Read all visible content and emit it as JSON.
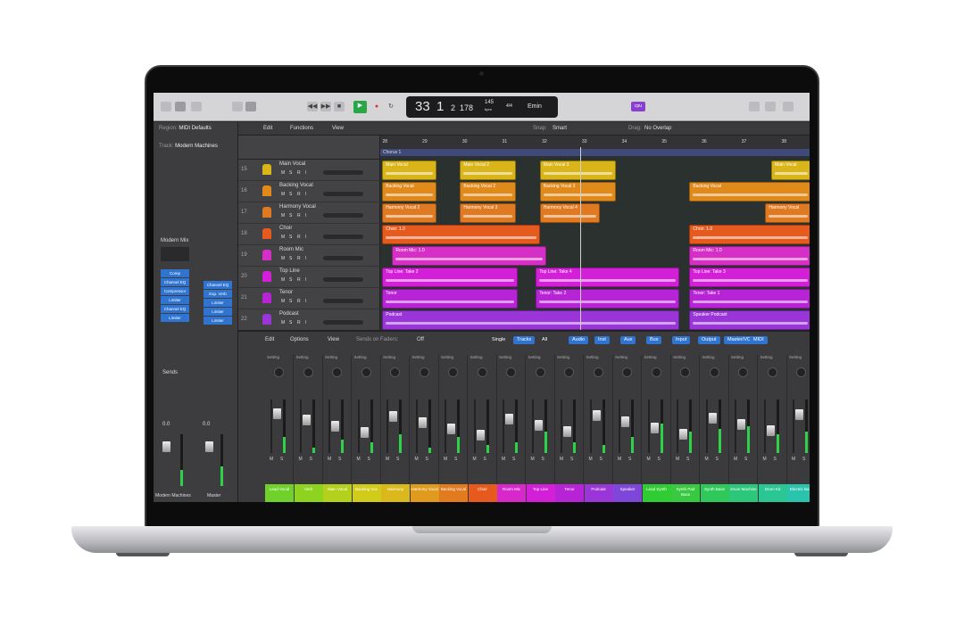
{
  "colors": {
    "accent": "#2f74d0",
    "play": "#27a745",
    "record": "#e0303a",
    "playhead": "#d0d0d0"
  },
  "control_bar": {
    "lcd": {
      "bar": "33",
      "beat": "1",
      "division": "2",
      "tick": "178",
      "tempo": "145",
      "tempo_label": "bpm",
      "signature": "4/4",
      "key": "Emin"
    },
    "badge": "cpu",
    "play_icon": "play-icon",
    "record_icon": "record-icon"
  },
  "arrange": {
    "menus": [
      "Edit",
      "Functions",
      "View"
    ],
    "snap_label": "Snap:",
    "snap_value": "Smart",
    "drag_label": "Drag:",
    "drag_value": "No Overlap",
    "ruler": [
      28,
      29,
      30,
      31,
      32,
      33,
      34,
      35,
      36,
      37,
      38
    ],
    "marker": "Chorus 1",
    "playhead_bar": 32.9,
    "tracks": [
      {
        "num": "15",
        "name": "Main Vocal",
        "color": "#d9b51a",
        "clips": [
          {
            "name": "Main Vocal",
            "start": 27.95,
            "end": 29.3
          },
          {
            "name": "Main Vocal 2",
            "start": 29.9,
            "end": 31.3
          },
          {
            "name": "Main Vocal 3",
            "start": 31.9,
            "end": 33.8
          },
          {
            "name": "Main Vocal",
            "start": 37.7,
            "end": 38.7
          }
        ]
      },
      {
        "num": "16",
        "name": "Backing Vocal",
        "color": "#e08a1c",
        "clips": [
          {
            "name": "Backing Vocal",
            "start": 27.95,
            "end": 29.3
          },
          {
            "name": "Backing Vocal 2",
            "start": 29.9,
            "end": 31.3
          },
          {
            "name": "Backing Vocal 3",
            "start": 31.9,
            "end": 33.8
          },
          {
            "name": "Backing Vocal",
            "start": 35.65,
            "end": 38.7
          }
        ]
      },
      {
        "num": "17",
        "name": "Harmony Vocal",
        "color": "#e07a22",
        "clips": [
          {
            "name": "Harmony Vocal 2",
            "start": 27.95,
            "end": 29.3
          },
          {
            "name": "Harmony Vocal 3",
            "start": 29.9,
            "end": 31.3
          },
          {
            "name": "Harmony Vocal 4",
            "start": 31.9,
            "end": 33.4
          },
          {
            "name": "Harmony Vocal",
            "start": 37.55,
            "end": 38.7
          }
        ]
      },
      {
        "num": "18",
        "name": "Choir",
        "color": "#e65a1e",
        "clips": [
          {
            "name": "Choir: 1.0",
            "start": 27.95,
            "end": 31.9
          },
          {
            "name": "Choir: 1.0",
            "start": 35.65,
            "end": 38.7
          }
        ]
      },
      {
        "num": "19",
        "name": "Room Mic",
        "color": "#d52fc6",
        "clips": [
          {
            "name": "Room Mic: 1.0",
            "start": 28.2,
            "end": 32.05
          },
          {
            "name": "Room Mic: 1.0",
            "start": 35.65,
            "end": 38.7
          }
        ]
      },
      {
        "num": "20",
        "name": "Top Line",
        "color": "#d41fd8",
        "clips": [
          {
            "name": "Top Line: Take 2",
            "start": 27.95,
            "end": 31.35
          },
          {
            "name": "Top Line: Take 4",
            "start": 31.8,
            "end": 35.4
          },
          {
            "name": "Top Line: Take 3",
            "start": 35.65,
            "end": 38.7
          }
        ]
      },
      {
        "num": "21",
        "name": "Tenor",
        "color": "#b624d6",
        "clips": [
          {
            "name": "Tenor",
            "start": 27.95,
            "end": 31.35
          },
          {
            "name": "Tenor: Take 2",
            "start": 31.8,
            "end": 35.4
          },
          {
            "name": "Tenor: Take 1",
            "start": 35.65,
            "end": 38.7
          }
        ]
      },
      {
        "num": "22",
        "name": "Podcast",
        "color": "#9a36d8",
        "clips": [
          {
            "name": "Podcast",
            "start": 27.95,
            "end": 35.4
          },
          {
            "name": "Speaker Podcast",
            "start": 35.65,
            "end": 38.7
          }
        ]
      }
    ],
    "track_buttons": [
      "M",
      "S",
      "R",
      "I"
    ]
  },
  "inspector": {
    "region_label": "Region:",
    "region_value": "MIDI Defaults",
    "track_label": "Track:",
    "track_value": "Modern Machines",
    "plugin_header": "Modern Mix",
    "plugins_left": [
      "Comp",
      "Channel EQ",
      "Compressor",
      "Limiter",
      "Channel EQ",
      "Limiter"
    ],
    "plugins_right": [
      "Channel EQ",
      "Exp. Verb",
      "Limiter",
      "Limiter",
      "Limiter"
    ],
    "sends": "Sends",
    "strip_left": "Modern Machines",
    "strip_right": "Master",
    "vol_left": "0.0",
    "vol_right": "0.0"
  },
  "mixer": {
    "menus": [
      "Edit",
      "Options",
      "View"
    ],
    "sends_label": "Sends on Faders:",
    "sends_value": "Off",
    "filters": [
      "Single",
      "Tracks",
      "All"
    ],
    "types": [
      "Audio",
      "Inst",
      "Aux",
      "Bus",
      "Input",
      "Output",
      "Master/VCA",
      "MIDI"
    ],
    "setting": "Setting",
    "channels": [
      {
        "name": "Lead Vocal",
        "color": "#6fd12a",
        "level": 0.3
      },
      {
        "name": "Verb",
        "color": "#8ed31f",
        "level": 0.1
      },
      {
        "name": "Main Vocal",
        "color": "#b3d11c",
        "level": 0.25
      },
      {
        "name": "Backing Vox",
        "color": "#d1cc1a",
        "level": 0.2
      },
      {
        "name": "Harmony",
        "color": "#dbb81b",
        "level": 0.35
      },
      {
        "name": "Harmony Vocal",
        "color": "#e09a1d",
        "level": 0.1
      },
      {
        "name": "Backing Vocal",
        "color": "#e27b1e",
        "level": 0.3
      },
      {
        "name": "Choir",
        "color": "#e65a1e",
        "level": 0.15
      },
      {
        "name": "Room Mic",
        "color": "#d728c9",
        "level": 0.2
      },
      {
        "name": "Top Line",
        "color": "#d41fd8",
        "level": 0.4
      },
      {
        "name": "Tenor",
        "color": "#b624d6",
        "level": 0.2
      },
      {
        "name": "Podcast",
        "color": "#9a36d8",
        "level": 0.15
      },
      {
        "name": "Speaker",
        "color": "#7f46da",
        "level": 0.3
      },
      {
        "name": "Lead Synth",
        "color": "#30cc33",
        "level": 0.55
      },
      {
        "name": "Synth Pad Bass",
        "color": "#38c940",
        "level": 0.4
      },
      {
        "name": "Synth Bass",
        "color": "#2ec95a",
        "level": 0.45
      },
      {
        "name": "Drum Machine",
        "color": "#2cc77a",
        "level": 0.5
      },
      {
        "name": "Drum Kit",
        "color": "#2ac694",
        "level": 0.35
      },
      {
        "name": "Electric Bass",
        "color": "#28c4ad",
        "level": 0.4
      }
    ],
    "strip_buttons": [
      "M",
      "S"
    ]
  }
}
